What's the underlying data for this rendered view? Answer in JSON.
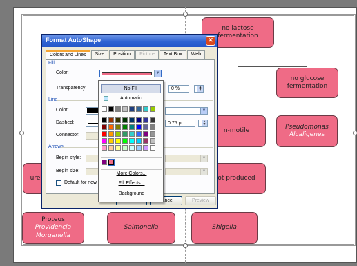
{
  "diagram": {
    "nodes": {
      "no_lactose": "no lactose fermentation",
      "no_glucose": "no glucose fermentation",
      "non_motile": "n-motile",
      "pseudomonas_1": "Pseudomonas",
      "pseudomonas_2": "Alcaligenes",
      "produced": "ot produced",
      "urease": "ure",
      "proteus_1": "Proteus",
      "proteus_2": "Providencia",
      "proteus_3": "Morganella",
      "salmonella": "Salmonella",
      "shigella": "Shigella"
    },
    "colors": {
      "node_fill": "#ef6b86",
      "node_border": "#6b3b46"
    }
  },
  "dialog": {
    "title": "Format AutoShape",
    "close_glyph": "✕",
    "tabs": [
      "Colors and Lines",
      "Size",
      "Position",
      "Picture",
      "Text Box",
      "Web"
    ],
    "fill_section": "Fill",
    "color_label": "Color:",
    "transparency_label": "Transparency:",
    "transparency_value": "0 %",
    "line_section": "Line",
    "line_color_label": "Color:",
    "dashed_label": "Dashed:",
    "connector_label": "Connector:",
    "weight_value": "0.75 pt",
    "arrows_section": "Arrows",
    "begin_style_label": "Begin style:",
    "begin_size_label": "Begin size:",
    "default_label": "Default for new ol",
    "ok_label": "OK",
    "cancel_label": "Cancel",
    "preview_label": "Preview",
    "current_fill": "#ef6b86"
  },
  "palette": {
    "no_fill": "No Fill",
    "automatic": "Automatic",
    "more_colors": "More Colors...",
    "fill_effects": "Fill Effects...",
    "background": "Background",
    "top_row": [
      "#ffffff",
      "#000000",
      "#808080",
      "#c0c0c0",
      "#1f3f7f",
      "#336699",
      "#33cccc",
      "#99cc00"
    ],
    "rows": [
      [
        "#000000",
        "#993300",
        "#333300",
        "#003300",
        "#003366",
        "#000080",
        "#333399",
        "#333333"
      ],
      [
        "#800000",
        "#ff6600",
        "#808000",
        "#008000",
        "#008080",
        "#0000ff",
        "#666699",
        "#808080"
      ],
      [
        "#ff0000",
        "#ff9900",
        "#99cc00",
        "#339966",
        "#33cccc",
        "#3366ff",
        "#800080",
        "#969696"
      ],
      [
        "#ff00ff",
        "#ffcc00",
        "#ffff00",
        "#00ff00",
        "#00ffff",
        "#00ccff",
        "#993366",
        "#c0c0c0"
      ],
      [
        "#ff99cc",
        "#ffcc99",
        "#ffff99",
        "#ccffcc",
        "#ccffff",
        "#99ccff",
        "#cc99ff",
        "#ffffff"
      ]
    ],
    "recent": [
      "#800080",
      "#ef6b86"
    ]
  }
}
